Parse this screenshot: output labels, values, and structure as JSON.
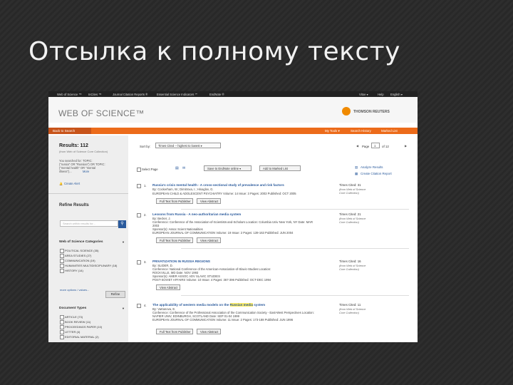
{
  "slide": {
    "title": "Отсылка к полному тексту"
  },
  "topbar": {
    "items": [
      "Web of Science ™",
      "InCites ™",
      "Journal Citation Reports ®",
      "Essential Science Indicators ℠",
      "EndNote ®"
    ],
    "right": [
      "Vitoe ▾",
      "Help",
      "English ▾"
    ]
  },
  "header": {
    "logo": "WEB OF SCIENCE™",
    "partner": "THOMSON REUTERS"
  },
  "nav": {
    "back": "Back to Search",
    "my_tools": "My Tools ▾",
    "history": "Search History",
    "marked": "Marked List"
  },
  "left": {
    "results_label": "Results: 112",
    "results_sub": "(from Web of Science Core Collection)",
    "searched_lines": [
      "You searched for: TOPIC:",
      "(\"russia\" OR \"Russian\") OR TOPIC:",
      "(\"mental health\" OR \"mental",
      "illness\")...",
      "More"
    ],
    "alert": "Create Alert",
    "refine_title": "Refine Results",
    "search_placeholder": "Search within results for...",
    "categories_title": "Web of Science Categories",
    "categories": [
      "POLITICAL SCIENCE (35)",
      "AREA STUDIES (27)",
      "COMMUNICATION (19)",
      "HUMANITIES MULTIDISCIPLINARY (18)",
      "HISTORY (14)"
    ],
    "more_options": "more options / values...",
    "refine_btn": "Refine",
    "doc_types_title": "Document Types",
    "doc_types": [
      "ARTICLE (73)",
      "BOOK REVIEW (11)",
      "PROCEEDINGS PAPER (10)",
      "LETTER (4)",
      "EDITORIAL MATERIAL (2)"
    ]
  },
  "toolbar": {
    "sort_label": "Sort by:",
    "sort_value": "Times Cited -- highest to lowest",
    "page_label": "Page",
    "page_value": "1",
    "page_of": "of  12",
    "select_page": "Select Page",
    "save_to": "Save to EndNote online",
    "add_marked": "Add to Marked List"
  },
  "right_tools": {
    "analyze": "Analyze Results",
    "citation": "Create Citation Report"
  },
  "records": [
    {
      "num": "1.",
      "title": "Russia's crisis mental health - A cross-sectional study of prevalence and risk factors",
      "meta": [
        "By: Cockerham, W.; Dimitrova, I.; Hinaglov, G.",
        "EUROPEAN CHILD & ADOLESCENT PSYCHIATRY  Volume: 14  Issue: 3  Pages: 2003  Published: OCT 2005"
      ],
      "cites": "Times Cited: 31",
      "cites_sub": [
        "(from Web of Science",
        "Core Collection)"
      ],
      "btn1": "Full Text from Publisher",
      "btn2": "View Abstract"
    },
    {
      "num": "2.",
      "title": "Lessons from Russia - A neo-authoritarian media system",
      "meta": [
        "By: Becker, J.",
        "Conference: Conference of the Association-of-Scientists-and-Scholars Location: Columbia Univ New York, NY Date: MAR",
        "2003",
        "Sponsor(s): Assoc Scient Nationalities",
        "EUROPEAN JOURNAL OF COMMUNICATION  Volume: 19  Issue: 2  Pages: 139-163  Published: JUN 2004"
      ],
      "cites": "Times Cited: 21",
      "cites_sub": [
        "(from Web of Science",
        "Core Collection)"
      ],
      "btn1": "Full Text from Publisher",
      "btn2": "View Abstract"
    },
    {
      "num": "3.",
      "title": "PRIVATIZATION IN RUSSIA REGIONS",
      "meta": [
        "By: SLIDER, D.",
        "Conference: National Conference of the American-Association-of-Slavic-Studies Location:",
        "ROCKVILLE, MD Date: NOV 1993",
        "Sponsor(s): AMER ASSOC ADV SLAVIC STUDIES",
        "POST-SOVIET AFFAIRS  Volume: 10  Issue: 4  Pages: 367-396  Published: OCT-DEC 1994"
      ],
      "cites": "Times Cited: 16",
      "cites_sub": [
        "(from Web of Science",
        "Core Collection)"
      ],
      "btn1": "",
      "btn2": "View Abstract"
    },
    {
      "num": "4.",
      "title_pre": "The applicability of western media models on the ",
      "title_hl": "Russian media",
      "title_post": " system",
      "meta": [
        "By: Vartanova, E.",
        "Conference: Conference of the Professional Association of the Communication Society - East-West Perspectives Location:",
        "NAPIER UNIV, EDINBURGH, SCOTLAND Date: SEP 01-04 1999",
        "EUROPEAN JOURNAL OF COMMUNICATION  Volume: 11  Issue: 2  Pages: 173-188  Published: JUN 1996"
      ],
      "cites": "Times Cited: 11",
      "cites_sub": [
        "(from Web of Science",
        "Core Collection)"
      ],
      "btn1": "Full Text from Publisher",
      "btn2": "View Abstract"
    }
  ]
}
